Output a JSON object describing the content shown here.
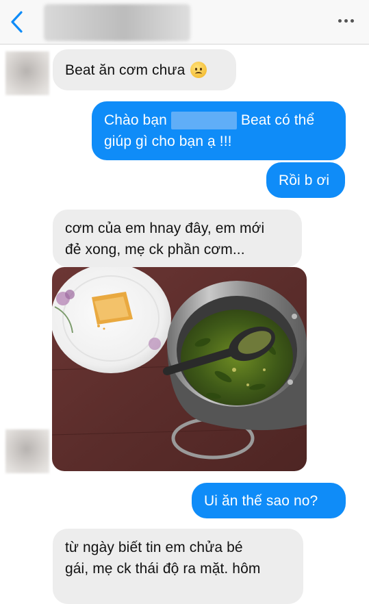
{
  "header": {
    "contact_name": "",
    "back_icon": "chevron-left-icon",
    "more_icon": "ellipsis-icon",
    "accent": "#0f8cf8"
  },
  "messages": {
    "m1": {
      "text": "Beat ăn cơm chưa",
      "emoji": "disappointed-face-icon"
    },
    "m2": {
      "line1_pre": "Chào bạn",
      "line1_post": "Beat có thể",
      "line2": "giúp gì cho bạn ạ !!!"
    },
    "m3": {
      "text": "Rồi b ơi"
    },
    "m4": {
      "line1": "cơm của em hnay đây, em mới",
      "line2": "đẻ xong, mẹ ck phần cơm..."
    },
    "m5": {
      "type": "photo",
      "alt": "plate-and-pot-photo"
    },
    "m6": {
      "text": "Ui ăn thế sao no?"
    },
    "m7": {
      "line1": "từ ngày biết tin em chửa bé",
      "line2": "gái, mẹ ck thái độ ra mặt. hôm"
    }
  },
  "colors": {
    "outgoing_bubble": "#0f8cf8",
    "incoming_bubble": "#ededed",
    "table": "#5e2f2d"
  }
}
